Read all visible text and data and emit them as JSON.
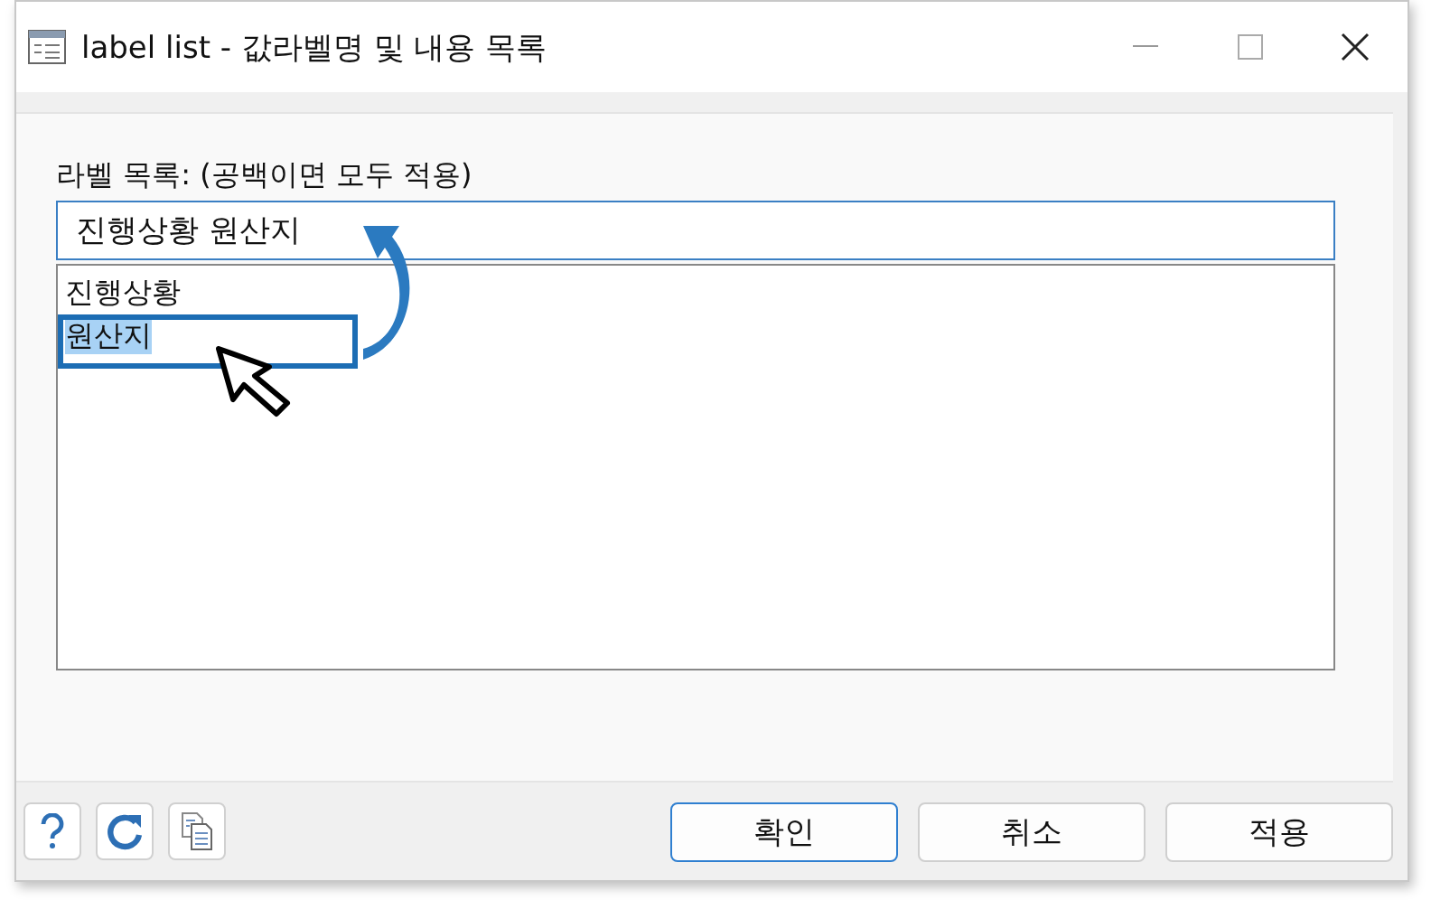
{
  "window": {
    "title": "label list - 값라벨명 및 내용 목록"
  },
  "label": "라벨 목록: (공백이면 모두 적용)",
  "field": {
    "value": "진행상황 원산지"
  },
  "list": [
    {
      "text": "진행상황",
      "selected": false
    },
    {
      "text": "원산지",
      "selected": true
    }
  ],
  "buttons": [
    {
      "label": "확인",
      "default": true
    },
    {
      "label": "취소",
      "default": false
    },
    {
      "label": "적용",
      "default": false
    }
  ]
}
